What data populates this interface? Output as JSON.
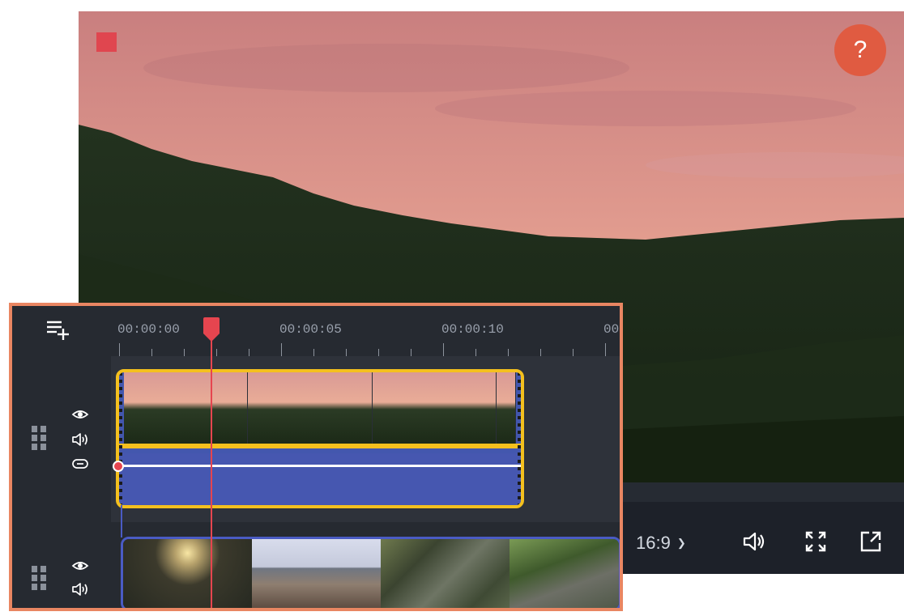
{
  "player": {
    "help_label": "?",
    "aspect_ratio": "16:9",
    "aspect_chevron": "v",
    "icons": [
      "volume-icon",
      "fullscreen-icon",
      "pop-out-icon"
    ]
  },
  "timeline": {
    "ruler": {
      "labels": [
        "00:00:00",
        "00:00:05",
        "00:00:10",
        "00:"
      ]
    },
    "overlay_track": {
      "icons": [
        "eye-icon",
        "speaker-icon",
        "link-icon"
      ]
    },
    "main_track": {
      "icons": [
        "eye-icon",
        "speaker-icon"
      ]
    },
    "playhead_color": "#e6454f",
    "selected_clip_border_color": "#f4c01e",
    "linked_clip_border_color": "#4a5bc4"
  },
  "colors": {
    "accent": "#e98662",
    "record": "#e0464f",
    "help": "#e05b41",
    "audio_track": "#4657b0"
  }
}
